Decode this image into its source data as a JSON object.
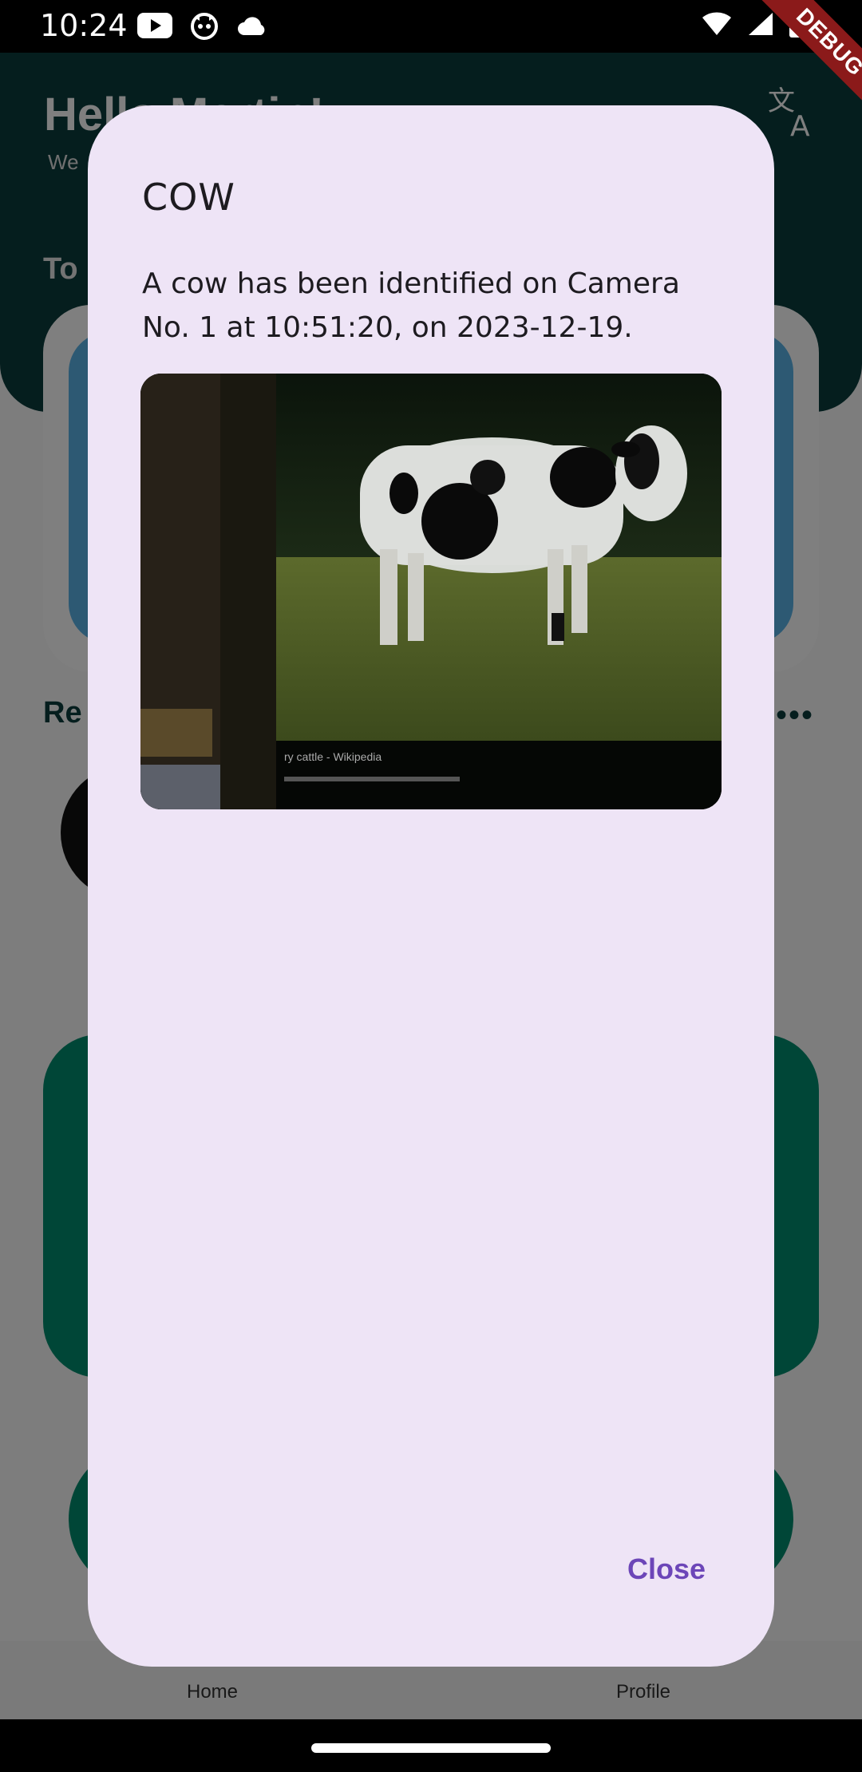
{
  "status_bar": {
    "time": "10:24",
    "left_icons": [
      "youtube-icon",
      "cat-face-icon",
      "cloud-icon"
    ],
    "right_icons": [
      "wifi-icon",
      "signal-icon",
      "battery-icon"
    ]
  },
  "debug_banner": {
    "label": "DEBUG"
  },
  "background_app": {
    "greeting": "Hello Martin!",
    "welcome": "We",
    "today_label": "To",
    "recent_label": "Re",
    "nav": {
      "home": "Home",
      "profile": "Profile"
    },
    "header_color": "#0b3d3d",
    "card_blue": "#5ab3e6",
    "card_green": "#008c6e"
  },
  "dialog": {
    "title": "COW",
    "message": "A cow has been identified on Camera No. 1 at 10:51:20, on 2023-12-19.",
    "image_caption": "ry cattle - Wikipedia",
    "close_label": "Close",
    "background": "#eee4f6",
    "accent": "#6c46b8"
  }
}
